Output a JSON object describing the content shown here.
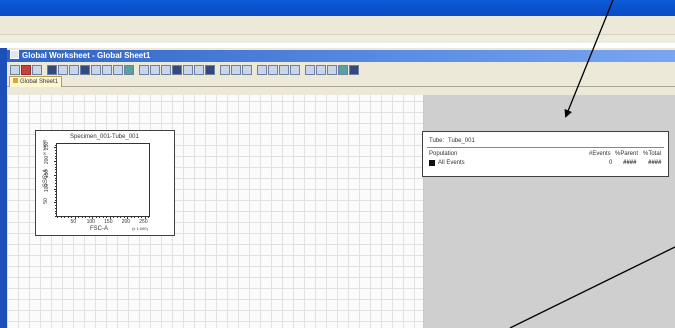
{
  "window": {
    "title": "Global Worksheet - Global Sheet1",
    "tab_label": "Global Sheet1"
  },
  "plot": {
    "title": "Specimen_001-Tube_001",
    "y_axis_label": "SSC-A",
    "y_scale_label": "(x 1,000)",
    "y_ticks": [
      "50",
      "100",
      "150",
      "200",
      "250"
    ],
    "x_axis_label": "FSC-A",
    "x_scale_label": "(x 1,000)",
    "x_ticks": [
      "50",
      "100",
      "150",
      "200",
      "250"
    ]
  },
  "stats": {
    "tube_label": "Tube:",
    "tube_value": "Tube_001",
    "headers": {
      "population": "Population",
      "events": "#Events",
      "parent": "%Parent",
      "total": "%Total"
    },
    "row": {
      "population": "All Events",
      "events": "0",
      "parent": "####",
      "total": "####",
      "swatch_color": "#111111"
    }
  },
  "colors": {
    "title_bar": "#0c5bd8",
    "worksheet_title": "#2f63c4",
    "gray_panel": "#cfcfcf"
  }
}
